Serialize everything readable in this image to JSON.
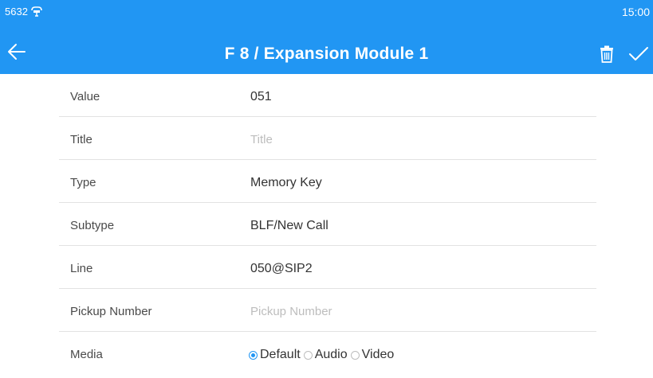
{
  "status_bar": {
    "extension": "5632",
    "time": "15:00",
    "phone_icon": "phone-forward-icon"
  },
  "header": {
    "title": "F 8 / Expansion Module 1",
    "back_icon": "arrow-left-icon",
    "delete_icon": "trash-icon",
    "save_icon": "check-icon"
  },
  "colors": {
    "header_bg": "#2196f3",
    "accent": "#2196f3"
  },
  "form": {
    "value": {
      "label": "Value",
      "value": "051"
    },
    "title": {
      "label": "Title",
      "placeholder": "Title"
    },
    "type": {
      "label": "Type",
      "value": "Memory Key"
    },
    "subtype": {
      "label": "Subtype",
      "value": "BLF/New Call"
    },
    "line": {
      "label": "Line",
      "value": "050@SIP2"
    },
    "pickup_number": {
      "label": "Pickup Number",
      "placeholder": "Pickup Number"
    },
    "media": {
      "label": "Media",
      "selected": "Default",
      "options": [
        "Default",
        "Audio",
        "Video"
      ]
    }
  }
}
